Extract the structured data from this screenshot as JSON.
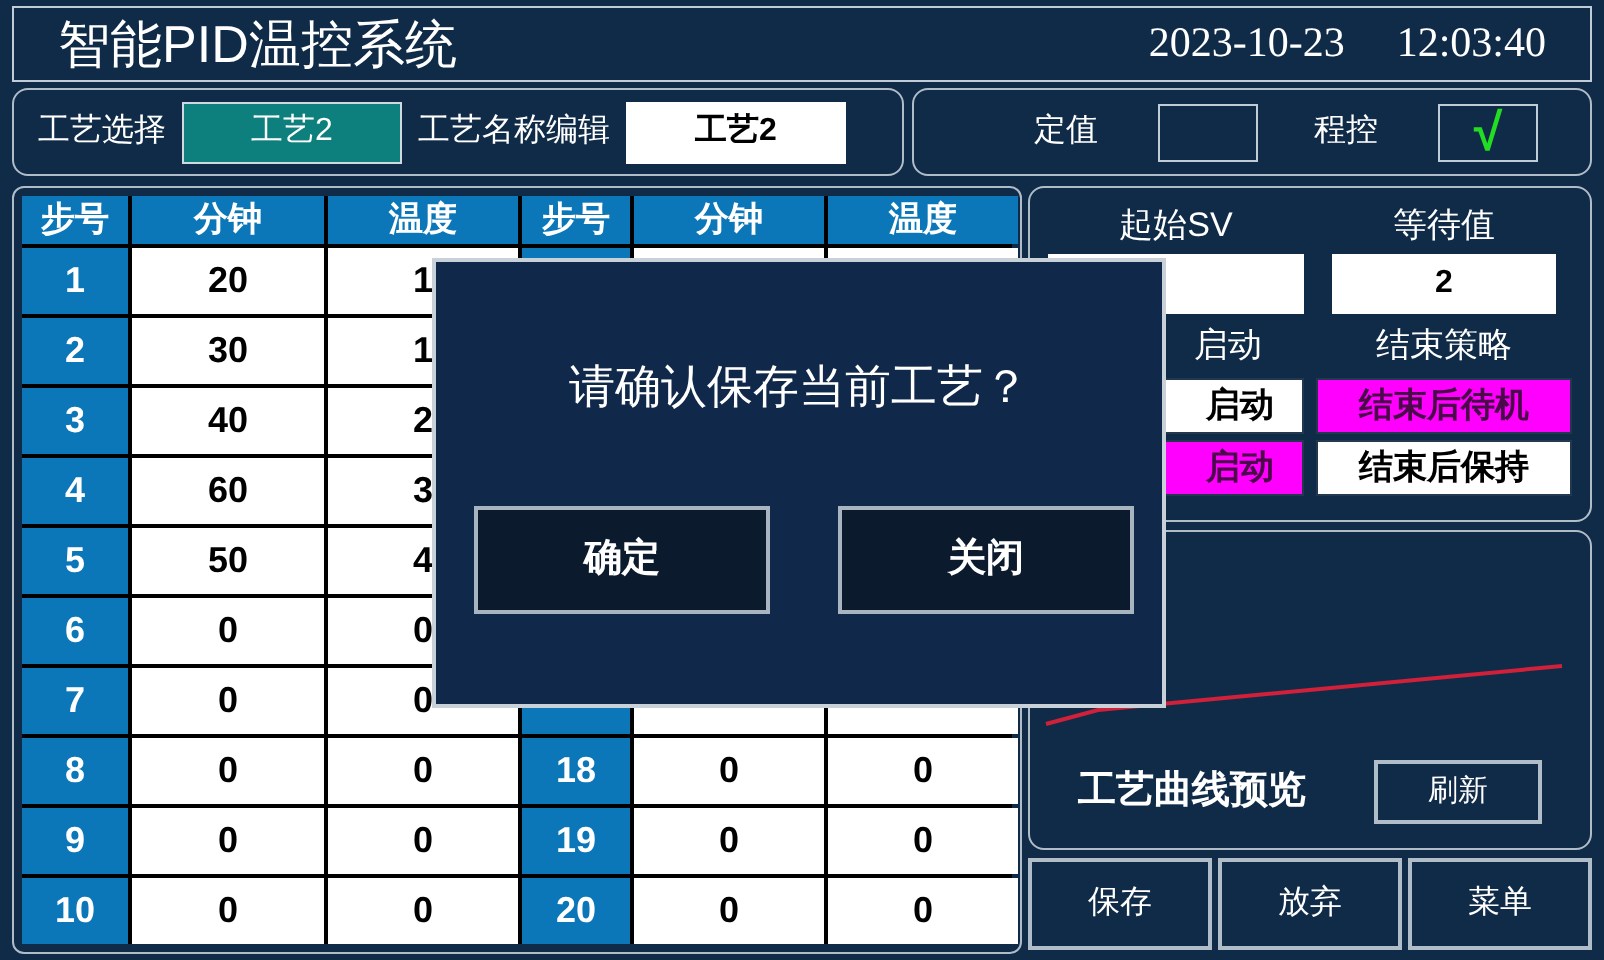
{
  "header": {
    "title": "智能PID温控系统",
    "date": "2023-10-23",
    "time": "12:03:40"
  },
  "recipe": {
    "select_label": "工艺选择",
    "selected_recipe": "工艺2",
    "name_label": "工艺名称编辑",
    "name_value": "工艺2"
  },
  "modes": {
    "check_glyph": "√",
    "items": [
      {
        "label": "定值",
        "checked": false
      },
      {
        "label": "程控",
        "checked": true
      }
    ]
  },
  "table": {
    "columns": [
      "步号",
      "分钟",
      "温度",
      "步号",
      "分钟",
      "温度"
    ],
    "left_rows": [
      {
        "step": "1",
        "minutes": "20",
        "temperature": "1"
      },
      {
        "step": "2",
        "minutes": "30",
        "temperature": "1"
      },
      {
        "step": "3",
        "minutes": "40",
        "temperature": "2"
      },
      {
        "step": "4",
        "minutes": "60",
        "temperature": "3"
      },
      {
        "step": "5",
        "minutes": "50",
        "temperature": "4"
      },
      {
        "step": "6",
        "minutes": "0",
        "temperature": "0"
      },
      {
        "step": "7",
        "minutes": "0",
        "temperature": "0"
      },
      {
        "step": "8",
        "minutes": "0",
        "temperature": "0"
      },
      {
        "step": "9",
        "minutes": "0",
        "temperature": "0"
      },
      {
        "step": "10",
        "minutes": "0",
        "temperature": "0"
      }
    ],
    "right_rows": [
      {
        "step": "18",
        "minutes": "0",
        "temperature": "0"
      },
      {
        "step": "19",
        "minutes": "0",
        "temperature": "0"
      },
      {
        "step": "20",
        "minutes": "0",
        "temperature": "0"
      }
    ]
  },
  "settings": {
    "start_sv": {
      "label": "起始SV"
    },
    "wait": {
      "label": "等待值",
      "value": "2"
    },
    "start_mode": {
      "label": "启动",
      "options": [
        {
          "label": "启动",
          "selected": false
        },
        {
          "label": "启动",
          "selected": true
        }
      ]
    },
    "end_strategy": {
      "label": "结束策略",
      "options": [
        {
          "label": "结束后待机",
          "selected": true
        },
        {
          "label": "结束后保持",
          "selected": false
        }
      ]
    }
  },
  "preview": {
    "label": "工艺曲线预览",
    "refresh": "刷新"
  },
  "bottom_buttons": [
    "保存",
    "放弃",
    "菜单"
  ],
  "dialog": {
    "message": "请确认保存当前工艺？",
    "buttons": [
      "确定",
      "关闭"
    ]
  }
}
